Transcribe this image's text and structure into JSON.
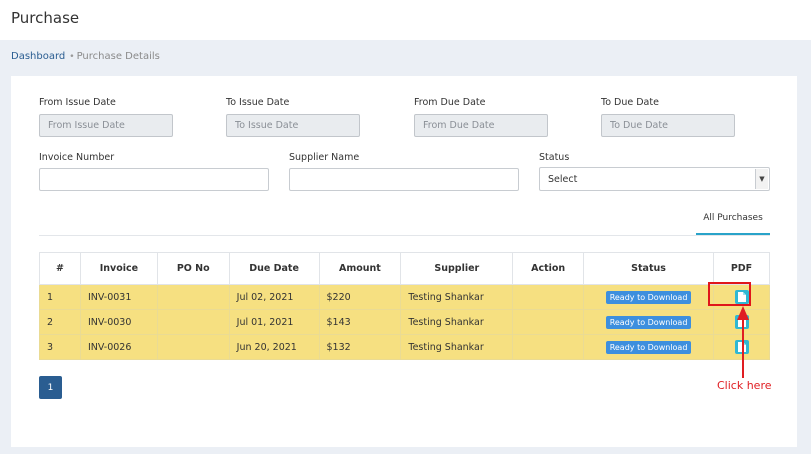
{
  "header": {
    "title": "Purchase"
  },
  "breadcrumb": {
    "home": "Dashboard",
    "separator": "•",
    "current": "Purchase Details"
  },
  "filters": {
    "from_issue": {
      "label": "From Issue Date",
      "placeholder": "From Issue Date"
    },
    "to_issue": {
      "label": "To Issue Date",
      "placeholder": "To Issue Date"
    },
    "from_due": {
      "label": "From Due Date",
      "placeholder": "From Due Date"
    },
    "to_due": {
      "label": "To Due Date",
      "placeholder": "To Due Date"
    },
    "invoice_number": {
      "label": "Invoice Number",
      "value": ""
    },
    "supplier_name": {
      "label": "Supplier Name",
      "value": ""
    },
    "status": {
      "label": "Status",
      "selected": "Select"
    }
  },
  "tabs": {
    "all_purchases": "All Purchases"
  },
  "table": {
    "headers": [
      "#",
      "Invoice",
      "PO No",
      "Due Date",
      "Amount",
      "Supplier",
      "Action",
      "Status",
      "PDF"
    ],
    "rows": [
      {
        "n": "1",
        "invoice": "INV-0031",
        "po": "",
        "due": "Jul 02, 2021",
        "amount": "$220",
        "supplier": "Testing Shankar",
        "action": "",
        "status": "Ready to Download"
      },
      {
        "n": "2",
        "invoice": "INV-0030",
        "po": "",
        "due": "Jul 01, 2021",
        "amount": "$143",
        "supplier": "Testing Shankar",
        "action": "",
        "status": "Ready to Download"
      },
      {
        "n": "3",
        "invoice": "INV-0026",
        "po": "",
        "due": "Jun 20, 2021",
        "amount": "$132",
        "supplier": "Testing Shankar",
        "action": "",
        "status": "Ready to Download"
      }
    ]
  },
  "pagination": {
    "current": "1"
  },
  "annotation": {
    "text": "Click here",
    "color": "#e01d22"
  },
  "colors": {
    "row_bg": "#f6e081",
    "badge": "#3d8fde",
    "pdf_icon": "#2fb8d3",
    "primary": "#2a5d91",
    "tab_underline": "#29a3c9"
  },
  "icons": {
    "pdf": "document-icon",
    "select": "caret-icon"
  }
}
